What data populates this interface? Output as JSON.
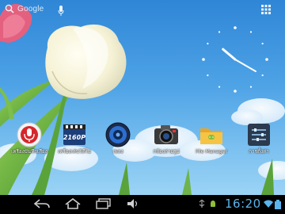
{
  "search": {
    "label": "Google"
  },
  "clock": {
    "hour": 10,
    "minute": 20
  },
  "apps": [
    {
      "label": "เครื่องบันทึกเสียง",
      "icon": "sound-recorder-icon"
    },
    {
      "label": "เครื่องเล่นวิดีโอ",
      "icon": "video-player-icon"
    },
    {
      "label": "เพลง",
      "icon": "music-icon"
    },
    {
      "label": "กล้องถ่ายรูป",
      "icon": "camera-icon"
    },
    {
      "label": "File Manager",
      "icon": "file-manager-icon"
    },
    {
      "label": "การตั้งค่า",
      "icon": "settings-icon"
    }
  ],
  "video_badge": "2160P",
  "system_bar": {
    "time": "16:20"
  },
  "colors": {
    "sky": "#4ea3e6",
    "time": "#5ab4ee",
    "navbar": "#000000"
  }
}
